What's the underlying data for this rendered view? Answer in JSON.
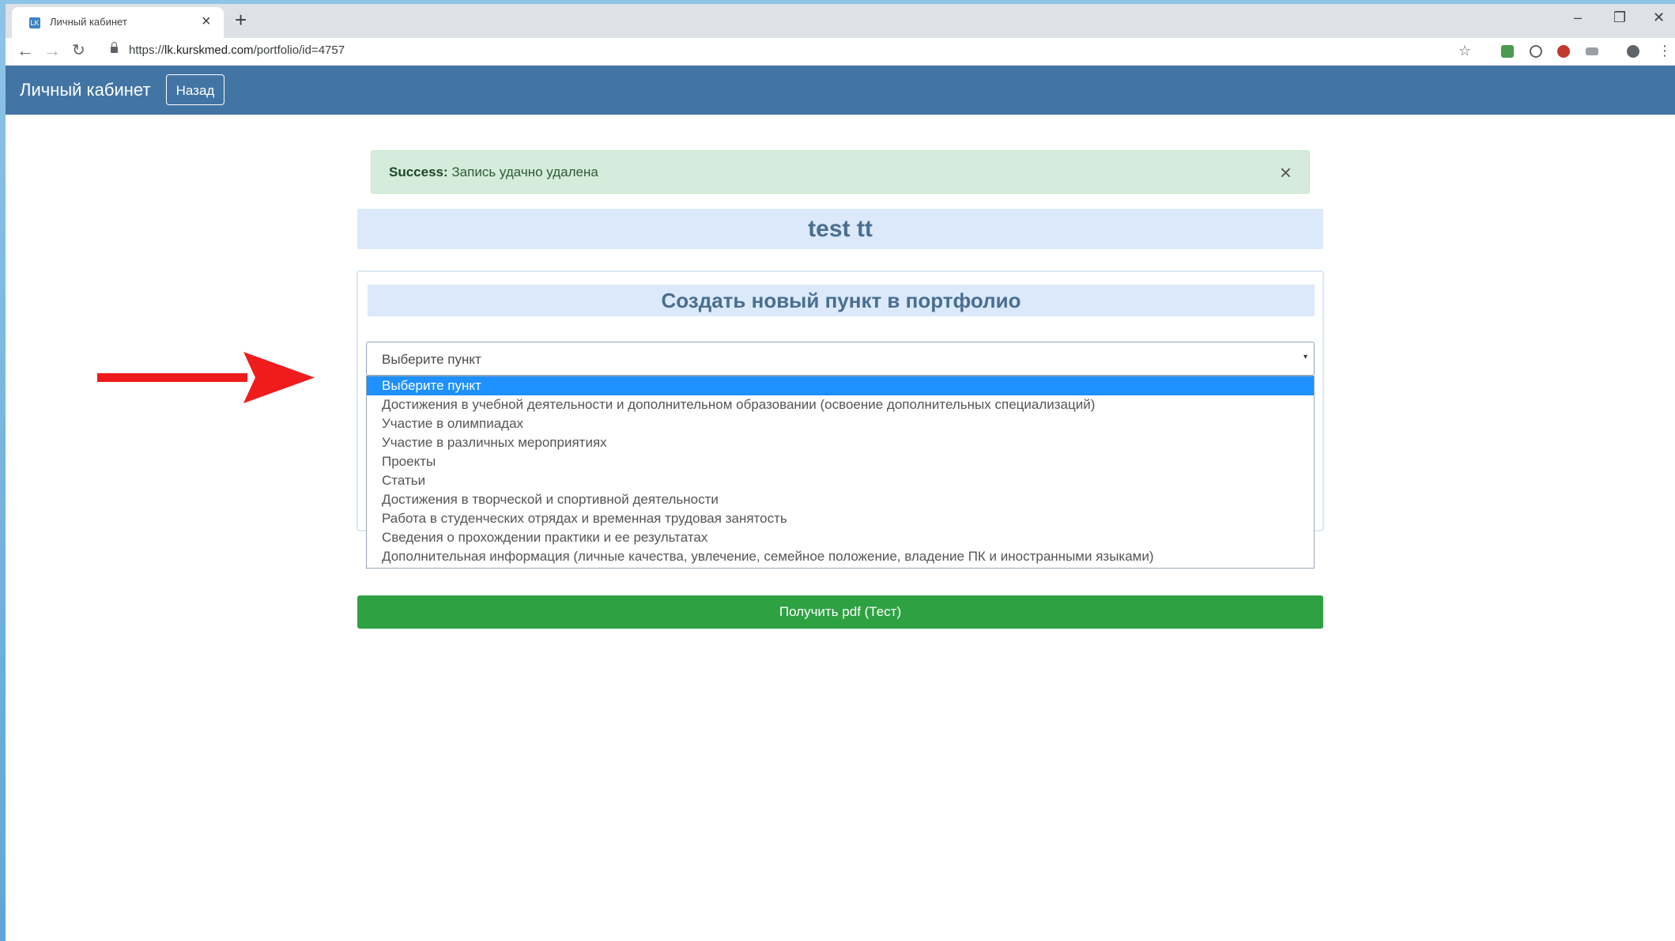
{
  "browser": {
    "tab_title": "Личный кабинет",
    "tab_favicon": "LK",
    "tab_close": "×",
    "new_tab": "+",
    "url_prefix": "https://",
    "url_host": "lk.kurskmed.com",
    "url_path": "/portfolio/id=4757",
    "window_controls": [
      "–",
      "❐",
      "✕"
    ]
  },
  "header": {
    "brand": "Личный кабинет",
    "back_button": "Назад",
    "background_color": "#4275a3"
  },
  "alert": {
    "label": "Success:",
    "message": "Запись удачно удалена",
    "close": "×"
  },
  "profile": {
    "name": "test tt"
  },
  "form": {
    "title": "Создать новый пункт в портфолио",
    "select_value": "Выберите пункт",
    "select_arrow": "▾",
    "options": [
      "Выберите пункт",
      "Достижения в учебной деятельности и дополнительном образовании (освоение дополнительных специализаций)",
      "Участие в олимпиадах",
      "Участие в различных мероприятиях",
      "Проекты",
      "Статьи",
      "Достижения в творческой и спортивной деятельности",
      "Работа в студенческих отрядах и временная трудовая занятость",
      "Сведения о прохождении практики и ее результатах",
      "Дополнительная информация (личные качества, увлечение, семейное положение, владение ПК и иностранными языками)"
    ],
    "selected_index": 0
  },
  "pdf_button": {
    "label": "Получить pdf (Тест)",
    "color": "#2ea243"
  },
  "annotation": {
    "arrow_color": "#ee1c1c"
  }
}
